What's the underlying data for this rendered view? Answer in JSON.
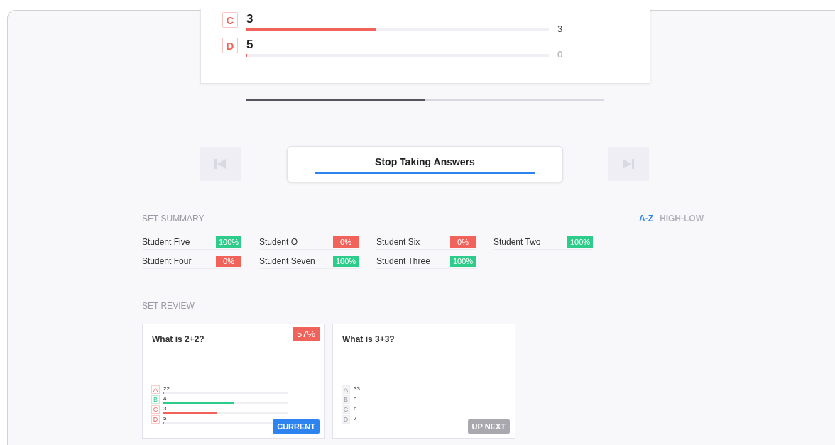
{
  "question_results": [
    {
      "letter": "C",
      "kind": "wrong",
      "answer": "3",
      "level": 0.43,
      "count": "3"
    },
    {
      "letter": "D",
      "kind": "wrong",
      "answer": "5",
      "level": 0,
      "count": "0"
    }
  ],
  "slide_progress": {
    "level": 0.5
  },
  "stop_button": {
    "label": "Stop Taking Answers"
  },
  "set_summary": {
    "title": "SET SUMMARY",
    "sort_options": [
      {
        "label": "A-Z",
        "selected": true
      },
      {
        "label": "HIGH-LOW",
        "selected": false
      }
    ],
    "students": [
      {
        "name": "Student Five",
        "score": "100%",
        "passed": true
      },
      {
        "name": "Student O",
        "score": "0%",
        "passed": false
      },
      {
        "name": "Student Six",
        "score": "0%",
        "passed": false
      },
      {
        "name": "Student Two",
        "score": "100%",
        "passed": true
      },
      {
        "name": "Student Four",
        "score": "0%",
        "passed": false
      },
      {
        "name": "Student Seven",
        "score": "100%",
        "passed": true
      },
      {
        "name": "Student Three",
        "score": "100%",
        "passed": true
      }
    ]
  },
  "set_review": {
    "title": "SET REVIEW",
    "cards": [
      {
        "question": "What is 2+2?",
        "score": "57%",
        "kind": "current",
        "status_label": "CURRENT",
        "answers": [
          {
            "letter": "A",
            "kind": "wrong",
            "answer": "22",
            "level": 0
          },
          {
            "letter": "B",
            "kind": "correct",
            "answer": "4",
            "level": 0.57
          },
          {
            "letter": "C",
            "kind": "wrong",
            "answer": "3",
            "level": 0.43
          },
          {
            "letter": "D",
            "kind": "wrong",
            "answer": "5",
            "level": 0
          }
        ]
      },
      {
        "question": "What is 3+3?",
        "kind": "next",
        "status_label": "UP NEXT",
        "answers": [
          {
            "letter": "A",
            "kind": "neutral",
            "answer": "33"
          },
          {
            "letter": "B",
            "kind": "neutral",
            "answer": "5"
          },
          {
            "letter": "C",
            "kind": "neutral",
            "answer": "6"
          },
          {
            "letter": "D",
            "kind": "neutral",
            "answer": "7"
          }
        ]
      }
    ]
  }
}
